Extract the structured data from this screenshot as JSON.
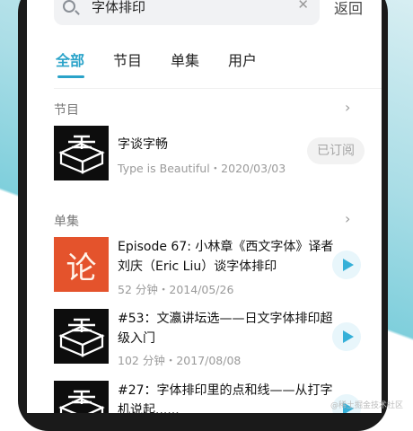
{
  "search": {
    "query": "字体排印",
    "back_label": "返回"
  },
  "tabs": [
    {
      "label": "全部",
      "active": true
    },
    {
      "label": "节目",
      "active": false
    },
    {
      "label": "单集",
      "active": false
    },
    {
      "label": "用户",
      "active": false
    }
  ],
  "programs": {
    "section_title": "节目",
    "items": [
      {
        "title": "字谈字畅",
        "meta": "Type is Beautiful・2020/03/03",
        "action_label": "已订阅",
        "thumb": "type-is-beautiful-logo"
      }
    ]
  },
  "episodes": {
    "section_title": "单集",
    "items": [
      {
        "title": "Episode 67: 小林章《西文字体》译者刘庆（Eric Liu）谈字体排印",
        "meta": "52 分钟・2014/05/26",
        "thumb": "论"
      },
      {
        "title": "#53：文瀛讲坛选——日文字体排印超级入门",
        "meta": "102 分钟・2017/08/08",
        "thumb": "type-is-beautiful-logo"
      },
      {
        "title": "#27：字体排印里的点和线——从打字机说起......",
        "meta": "",
        "thumb": "type-is-beautiful-logo"
      }
    ]
  },
  "watermark": "@稀土掘金技术社区",
  "colors": {
    "accent": "#2aa3c9",
    "play_icon": "#35b0d8",
    "episode_thumb_red": "#e4532c"
  }
}
